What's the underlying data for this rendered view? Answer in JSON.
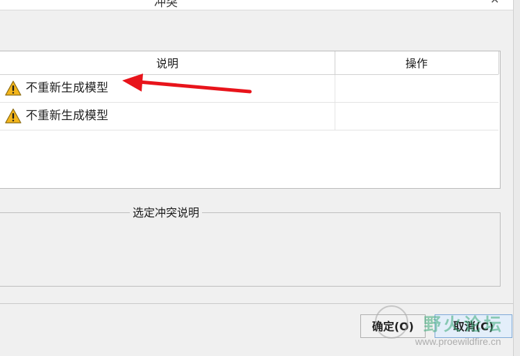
{
  "window": {
    "title": "冲突",
    "close_glyph": "✕"
  },
  "table": {
    "columns": [
      "说明",
      "操作"
    ],
    "rows": [
      {
        "icon": "warning-icon",
        "description": "不重新生成模型",
        "action": ""
      },
      {
        "icon": "warning-icon",
        "description": "不重新生成模型",
        "action": ""
      }
    ]
  },
  "details_group": {
    "legend": "选定冲突说明",
    "content": ""
  },
  "buttons": {
    "ok": "确定(O)",
    "cancel": "取消(C)"
  },
  "watermark": {
    "name": "野火论坛",
    "url": "www.proewildfire.cn"
  },
  "colors": {
    "annotation_arrow": "#e8141b",
    "warning_fill": "#f3b51b"
  }
}
